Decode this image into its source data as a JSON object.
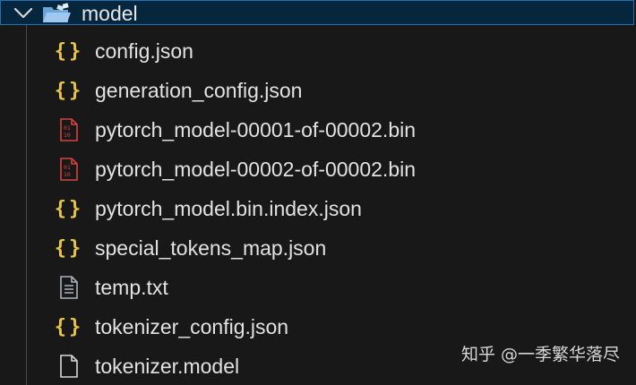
{
  "folder": {
    "label": "model",
    "expanded": true,
    "chevron_icon": "chevron-down-icon",
    "folder_icon": "folder-open-icon"
  },
  "files": [
    {
      "label": "config.json",
      "icon": "json-icon"
    },
    {
      "label": "generation_config.json",
      "icon": "json-icon"
    },
    {
      "label": "pytorch_model-00001-of-00002.bin",
      "icon": "binary-file-icon"
    },
    {
      "label": "pytorch_model-00002-of-00002.bin",
      "icon": "binary-file-icon"
    },
    {
      "label": "pytorch_model.bin.index.json",
      "icon": "json-icon"
    },
    {
      "label": "special_tokens_map.json",
      "icon": "json-icon"
    },
    {
      "label": "temp.txt",
      "icon": "text-file-icon"
    },
    {
      "label": "tokenizer_config.json",
      "icon": "json-icon"
    },
    {
      "label": "tokenizer.model",
      "icon": "generic-file-icon"
    }
  ],
  "icons": {
    "json_glyph": "{}",
    "binary_glyph": "01\n10"
  },
  "watermark": "知乎 @一季繁华落尽",
  "colors": {
    "background": "#181818",
    "selected_row": "#05263d",
    "selected_border": "#1f6fb5",
    "json_icon": "#e8c547",
    "binary_icon": "#d2453d",
    "text": "#e2e2e2"
  }
}
